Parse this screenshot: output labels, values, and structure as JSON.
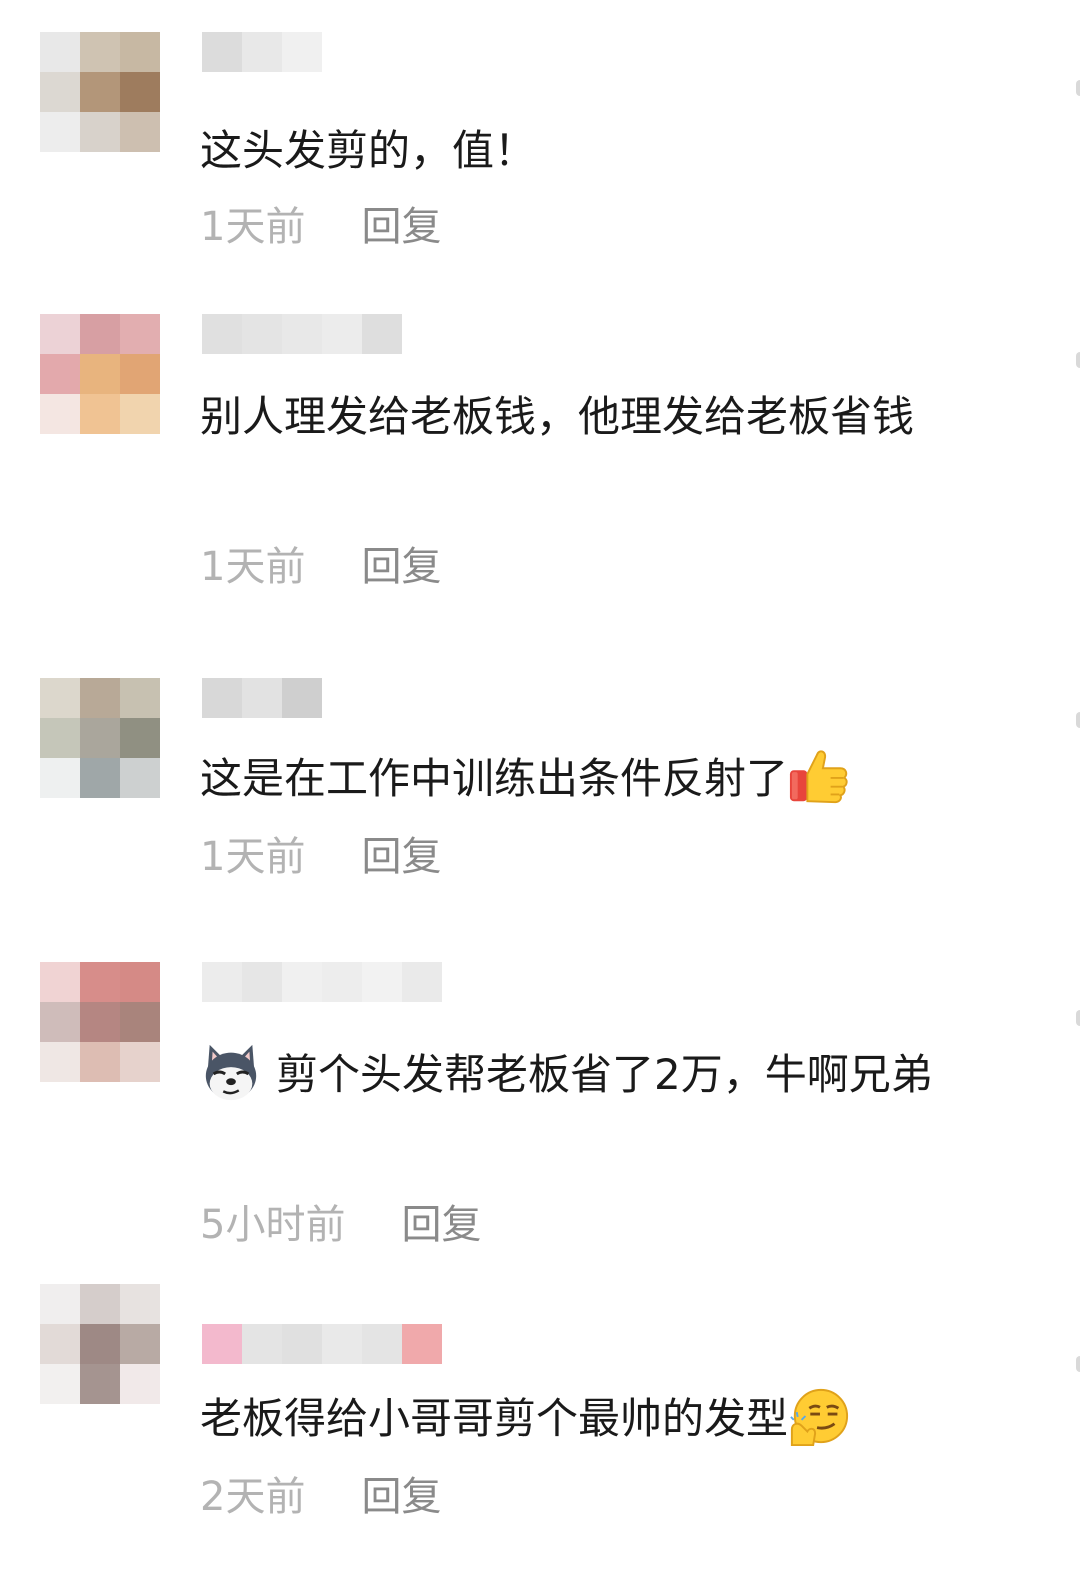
{
  "comments": [
    {
      "text": "这头发剪的，值！",
      "time": "1天前",
      "reply": "回复",
      "avatar_colors": [
        "#e8e8e8",
        "#cfc3b2",
        "#c7b8a3",
        "#dcd8d2",
        "#b39679",
        "#9e7c5e",
        "#ededed",
        "#d8d2cb",
        "#cdbfb0"
      ],
      "name_colors": [
        "#dcdcdc",
        "#e8e8e8",
        "#f0f0f0"
      ]
    },
    {
      "text": "别人理发给老板钱，他理发给老板省钱",
      "time": "1天前",
      "reply": "回复",
      "avatar_colors": [
        "#ecd2d6",
        "#d79fa3",
        "#e2aeb0",
        "#e3a9ac",
        "#e8b47e",
        "#e1a574",
        "#f4e6e2",
        "#f0c393",
        "#f1d4ae"
      ],
      "name_colors": [
        "#e0e0e0",
        "#e4e4e4",
        "#e8e8e8",
        "#ececec",
        "#dedede"
      ]
    },
    {
      "text": "这是在工作中训练出条件反射了",
      "emoji_after": "thumbs-up",
      "time": "1天前",
      "reply": "回复",
      "avatar_colors": [
        "#dcd7cc",
        "#b8a997",
        "#c7c1b1",
        "#c5c6b9",
        "#aaa69c",
        "#909082",
        "#eef0f0",
        "#9fa7a8",
        "#cdd0d0"
      ],
      "name_colors": [
        "#d8d8d8",
        "#e2e2e2",
        "#cfcfcf"
      ]
    },
    {
      "text": "剪个头发帮老板省了2万，牛啊兄弟",
      "emoji_before": "doge",
      "time": "5小时前",
      "reply": "回复",
      "avatar_colors": [
        "#f0d3d3",
        "#d78d8a",
        "#d58a86",
        "#cfbcba",
        "#b58682",
        "#a9847c",
        "#efe7e4",
        "#ddbdb3",
        "#e6d2cc"
      ],
      "name_colors": [
        "#ececec",
        "#e6e6e6",
        "#f0f0f0",
        "#ededed",
        "#f2f2f2",
        "#eaeaea"
      ]
    },
    {
      "text": "老板得给小哥哥剪个最帅的发型",
      "emoji_after": "smirk",
      "time": "2天前",
      "reply": "回复",
      "avatar_colors": [
        "#f0eeee",
        "#d5cdcb",
        "#e7e2e0",
        "#e2dad7",
        "#9e8985",
        "#b8aaa4",
        "#f2f0ef",
        "#a59490",
        "#f1e9e9"
      ],
      "name_colors": [
        "#f3b9cd",
        "#e4e4e4",
        "#e0e0e0",
        "#e9e9e9",
        "#e4e4e4",
        "#f0a9ab"
      ]
    }
  ]
}
